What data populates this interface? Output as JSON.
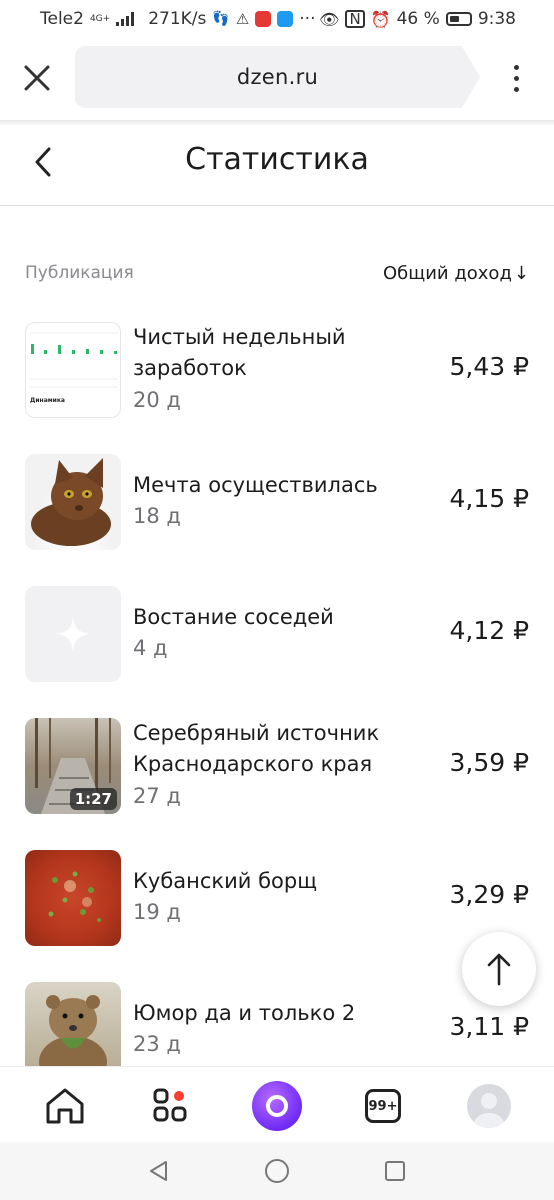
{
  "status_bar": {
    "carrier": "Tele2",
    "network_tag": "4G+",
    "speed": "271K/s",
    "battery": "46 %",
    "time": "9:38"
  },
  "browser": {
    "url": "dzen.ru"
  },
  "header": {
    "title": "Статистика"
  },
  "table": {
    "col_publication": "Публикация",
    "col_income": "Общий доход",
    "sort_arrow": "↓"
  },
  "rows": [
    {
      "title": "Чистый недельный заработок",
      "age": "20 д",
      "income": "5,43 ₽",
      "thumb": "chart-thumbnail",
      "thumb_caption": "Динамика"
    },
    {
      "title": "Мечта осуществилась",
      "age": "18 д",
      "income": "4,15 ₽",
      "thumb": "cat-thumbnail"
    },
    {
      "title": "Востание соседей",
      "age": "4 д",
      "income": "4,12 ₽",
      "thumb": "placeholder-thumbnail"
    },
    {
      "title": "Серебряный источник Краснодарского края",
      "age": "27 д",
      "income": "3,59 ₽",
      "thumb": "forest-thumbnail",
      "duration": "1:27"
    },
    {
      "title": "Кубанский борщ",
      "age": "19 д",
      "income": "3,29 ₽",
      "thumb": "borsch-thumbnail"
    },
    {
      "title": "Юмор да и только 2",
      "age": "23 д",
      "income": "3,11 ₽",
      "thumb": "quokka-thumbnail"
    }
  ],
  "bottom_nav": {
    "notifications_badge": "99+"
  },
  "colors": {
    "accent_alice": "#7b32f5",
    "notification_dot": "#ff3b30",
    "secondary_text": "#8a8a8f"
  }
}
